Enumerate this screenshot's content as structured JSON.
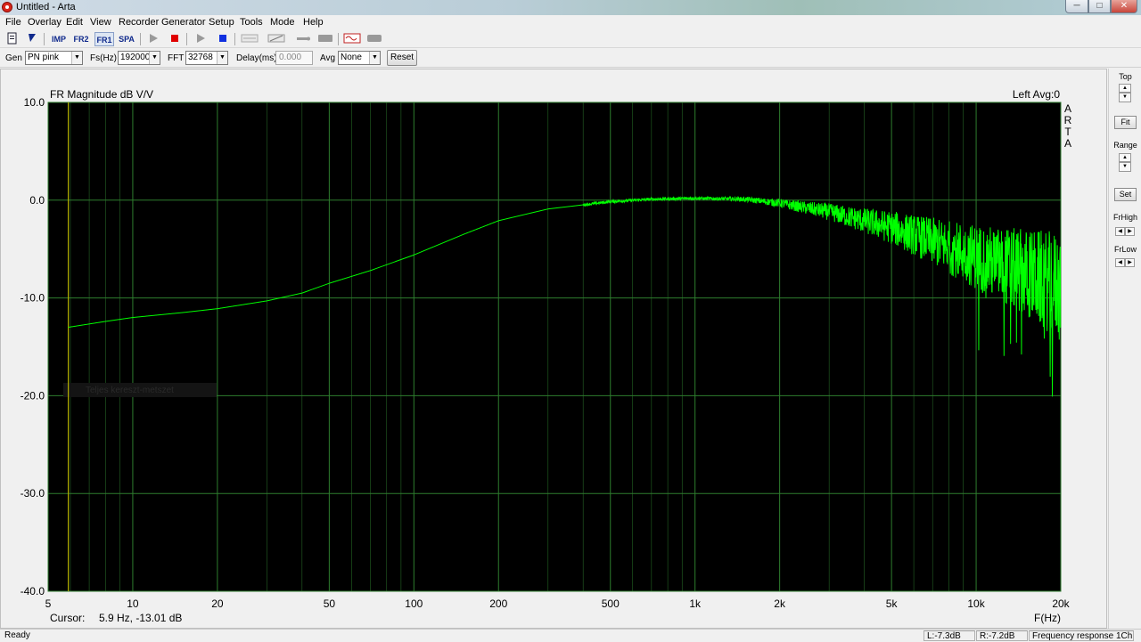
{
  "window": {
    "title": "Untitled - Arta",
    "min": "─",
    "max": "□",
    "close": "✕"
  },
  "menu": [
    "File",
    "Overlay",
    "Edit",
    "View",
    "Recorder",
    "Generator",
    "Setup",
    "Tools",
    "Mode",
    "Help"
  ],
  "toolbar": {
    "imp": "IMP",
    "fr2": "FR2",
    "fr1": "FR1",
    "spa": "SPA"
  },
  "params": {
    "gen_label": "Gen",
    "gen_value": "PN pink",
    "fs_label": "Fs(Hz)",
    "fs_value": "192000",
    "fft_label": "FFT",
    "fft_value": "32768",
    "delay_label": "Delay(ms)",
    "delay_value": "0.000",
    "avg_label": "Avg",
    "avg_value": "None",
    "reset_label": "Reset"
  },
  "right_panel": {
    "top": "Top",
    "fit": "Fit",
    "range": "Range",
    "set": "Set",
    "frhigh": "FrHigh",
    "frlow": "FrLow"
  },
  "status": {
    "ready": "Ready",
    "left": "L:-7.3dB",
    "right": "R:-7.2dB",
    "mode": "Frequency response 1Ch"
  },
  "graph_info": {
    "channel": "Left  Avg:0",
    "brand": [
      "A",
      "R",
      "T",
      "A"
    ],
    "cursor_label": "Cursor:",
    "cursor_value": "5.9 Hz, -13.01 dB",
    "overlay_label": "Teljes kereszt-metszet"
  },
  "colors": {
    "trace": "#00ff00",
    "grid": "#2e7d2e",
    "cursor": "#b9b400",
    "background": "#000000"
  },
  "chart_data": {
    "type": "line",
    "title": "FR Magnitude dB V/V",
    "xlabel": "F(Hz)",
    "ylabel": "",
    "x_scale": "log",
    "xlim": [
      5,
      20000
    ],
    "ylim": [
      -40,
      10
    ],
    "x_ticks": [
      5,
      10,
      20,
      50,
      100,
      200,
      500,
      1000,
      2000,
      5000,
      10000,
      20000
    ],
    "x_tick_labels": [
      "5",
      "10",
      "20",
      "50",
      "100",
      "200",
      "500",
      "1k",
      "2k",
      "5k",
      "10k",
      "20k"
    ],
    "y_ticks": [
      10,
      0,
      -10,
      -20,
      -30,
      -40
    ],
    "y_tick_labels": [
      "10.0",
      "0.0",
      "-10.0",
      "-20.0",
      "-30.0",
      "-40.0"
    ],
    "grid": true,
    "cursor": {
      "x": 5.9,
      "y": -13.01
    },
    "series": [
      {
        "x": [
          5.9,
          8,
          10,
          15,
          20,
          30,
          40,
          50,
          70,
          100,
          150,
          200,
          300,
          500,
          700,
          1000,
          1500,
          2000,
          3000,
          5000,
          7000,
          10000,
          15000,
          20000
        ],
        "y": [
          -13.0,
          -12.4,
          -12.0,
          -11.5,
          -11.1,
          -10.3,
          -9.5,
          -8.5,
          -7.2,
          -5.6,
          -3.5,
          -2.1,
          -0.9,
          -0.15,
          0.1,
          0.2,
          0.1,
          -0.3,
          -1.2,
          -2.8,
          -4.2,
          -5.8,
          -7.5,
          -8.8
        ]
      }
    ]
  }
}
